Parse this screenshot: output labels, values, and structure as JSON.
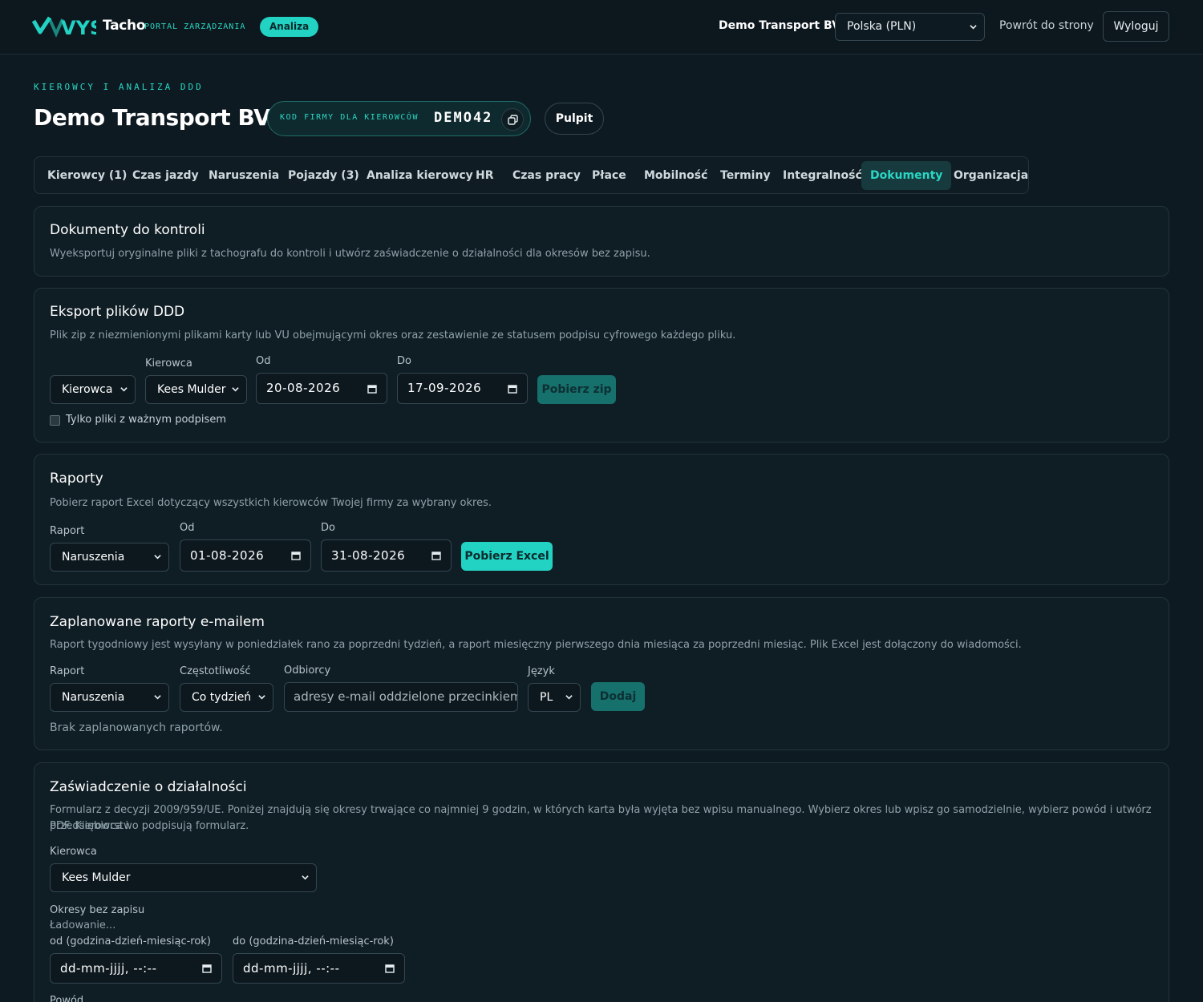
{
  "topbar": {
    "logo_text": "VYS",
    "brand": "Tacho",
    "brand_sub": "PORTAL ZARZĄDZANIA",
    "badge": "Analiza",
    "company": "Demo Transport BV",
    "country_select": "Polska (PLN)",
    "back_link": "Powrót do strony",
    "logout": "Wyloguj"
  },
  "header": {
    "eyebrow": "KIEROWCY I ANALIZA DDD",
    "title": "Demo Transport BV",
    "code_label": "KOD FIRMY DLA KIEROWCÓW",
    "code_value": "DEMO42",
    "dashboard_button": "Pulpit"
  },
  "tabs": [
    {
      "label": "Kierowcy (1)",
      "active": false
    },
    {
      "label": "Czas jazdy",
      "active": false
    },
    {
      "label": "Naruszenia",
      "active": false
    },
    {
      "label": "Pojazdy (3)",
      "active": false
    },
    {
      "label": "Analiza kierowcy",
      "active": false
    },
    {
      "label": "HR",
      "active": false
    },
    {
      "label": "Czas pracy",
      "active": false
    },
    {
      "label": "Płace",
      "active": false
    },
    {
      "label": "Mobilność",
      "active": false
    },
    {
      "label": "Terminy",
      "active": false
    },
    {
      "label": "Integralność",
      "active": false
    },
    {
      "label": "Dokumenty",
      "active": true
    },
    {
      "label": "Organizacja",
      "active": false
    }
  ],
  "docs_card": {
    "title": "Dokumenty do kontroli",
    "desc": "Wyeksportuj oryginalne pliki z tachografu do kontroli i utwórz zaświadczenie o działalności dla okresów bez zapisu."
  },
  "export_card": {
    "title": "Eksport plików DDD",
    "desc": "Plik zip z niezmienionymi plikami karty lub VU obejmującymi okres oraz zestawienie ze statusem podpisu cyfrowego każdego pliku.",
    "type_select": "Kierowca",
    "driver_label": "Kierowca",
    "driver_select": "Kees Mulder",
    "from_label": "Od",
    "from_value": "20-08-2026",
    "to_label": "Do",
    "to_value": "17-09-2026",
    "button": "Pobierz zip",
    "checkbox_label": "Tylko pliki z ważnym podpisem",
    "checkbox_checked": false
  },
  "reports_card": {
    "title": "Raporty",
    "desc": "Pobierz raport Excel dotyczący wszystkich kierowców Twojej firmy za wybrany okres.",
    "report_label": "Raport",
    "report_select": "Naruszenia",
    "from_label": "Od",
    "from_value": "01-08-2026",
    "to_label": "Do",
    "to_value": "31-08-2026",
    "button": "Pobierz Excel"
  },
  "scheduled_card": {
    "title": "Zaplanowane raporty e-mailem",
    "desc": "Raport tygodniowy jest wysyłany w poniedziałek rano za poprzedni tydzień, a raport miesięczny pierwszego dnia miesiąca za poprzedni miesiąc. Plik Excel jest dołączony do wiadomości.",
    "report_label": "Raport",
    "report_select": "Naruszenia",
    "freq_label": "Częstotliwość",
    "freq_select": "Co tydzień",
    "recipients_label": "Odbiorcy",
    "recipients_placeholder": "adresy e-mail oddzielone przecinkiem",
    "lang_label": "Język",
    "lang_select": "PL",
    "button": "Dodaj",
    "empty_note": "Brak zaplanowanych raportów."
  },
  "attestation_card": {
    "title": "Zaświadczenie o działalności",
    "desc_line1": "Formularz z decyzji 2009/959/UE. Poniżej znajdują się okresy trwające co najmniej 9 godzin, w których karta była wyjęta bez wpisu manualnego. Wybierz okres lub wpisz go samodzielnie, wybierz powód i utwórz PDF. Kierowca i",
    "desc_line2": "przedsiębiorstwo podpisują formularz.",
    "driver_label": "Kierowca",
    "driver_select": "Kees Mulder",
    "periods_label": "Okresy bez zapisu",
    "loading": "Ładowanie...",
    "from_label": "od (godzina-dzień-miesiąc-rok)",
    "from_placeholder": "dd-mm-jjjj, --:--",
    "to_label": "do (godzina-dzień-miesiąc-rok)",
    "to_placeholder": "dd-mm-jjjj, --:--",
    "reason_label": "Powód"
  },
  "colors": {
    "background": "#0e1a21",
    "accent": "#22d3c3",
    "card": "#0f1d24",
    "border": "#23343c"
  }
}
